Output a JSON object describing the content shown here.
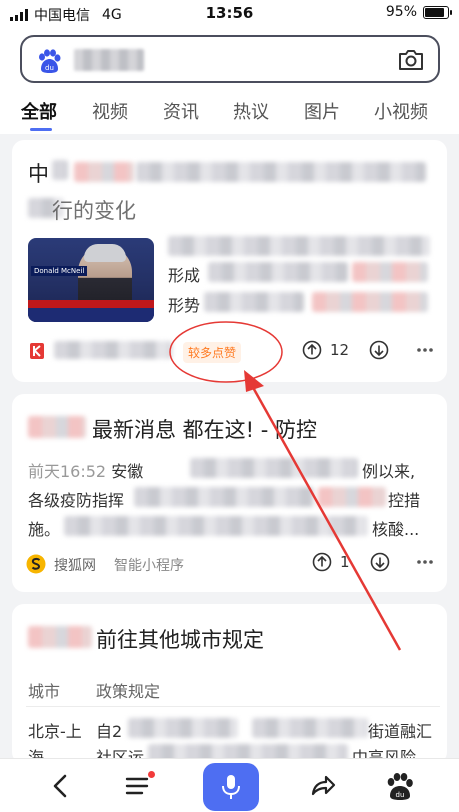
{
  "status_bar": {
    "carrier": "中国电信",
    "network": "4G",
    "time": "13:56",
    "battery": "95%"
  },
  "tabs": [
    {
      "label": "全部"
    },
    {
      "label": "视频"
    },
    {
      "label": "资讯"
    },
    {
      "label": "热议"
    },
    {
      "label": "图片"
    },
    {
      "label": "小视频"
    }
  ],
  "results": {
    "r1": {
      "title_start": "中",
      "title_line2": "行的变化",
      "snippet_l2": "形成",
      "snippet_l3": "形势",
      "thumb_name": "Donald McNeil",
      "badge": "较多点赞",
      "likes": "12"
    },
    "r2": {
      "title_end": "最新消息 都在这! - 防控",
      "snippet_time": "前天16:52",
      "snippet_l1": "安徽",
      "snippet_l1_end": "例以来,",
      "snippet_l2": "各级疫防指挥",
      "snippet_l2_end": "控措",
      "snippet_l3": "施。",
      "snippet_l3_end": "核酸...",
      "source": "搜狐网",
      "source_type": "智能小程序",
      "likes": "1"
    },
    "r3": {
      "title_end": "前往其他城市规定",
      "col_city": "城市",
      "col_policy": "政策规定",
      "row1_city": "北京-上",
      "row1_city_line2": "海",
      "row1_policy": "自2",
      "row1_policy_end": "街道融汇",
      "row1_policy_l2": "社区运",
      "row1_policy_l2_end": "中高风险"
    }
  },
  "colors": {
    "accent": "#4e6ef2",
    "badge_text": "#ff7a21",
    "annotation_red": "#e53935"
  },
  "icons": {
    "search_logo": "baidu-paw-icon",
    "camera": "camera-icon",
    "back": "chevron-left-icon",
    "menu": "menu-icon",
    "voice": "microphone-icon",
    "share": "share-icon",
    "home": "baidu-paw-icon"
  }
}
